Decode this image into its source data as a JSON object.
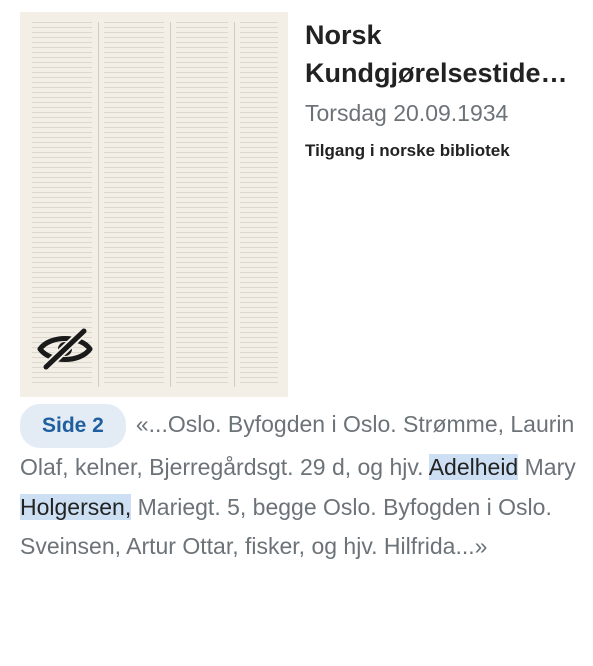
{
  "document": {
    "title_line1": "Norsk",
    "title_line2": "Kundgjørelsestide…",
    "date": "Torsdag 20.09.1934",
    "access": "Tilgang i norske bibliotek",
    "visibility_icon": "eye-slash-icon"
  },
  "snippet": {
    "page_label": "Side 2",
    "text_before": "«...Oslo. Byfogden i Oslo. Strømme, Laurin Olaf, kelner, Bjerregårdsgt. 29 d, og hjv. ",
    "highlight_1": "Adelheid",
    "text_middle": " Mary ",
    "highlight_2": "Holgersen,",
    "text_after": " Mariegt. 5, begge Oslo. Byfogden i Oslo. Sveinsen, Artur Ottar, fisker, og hjv. Hilfrida...»"
  },
  "colors": {
    "chip_bg": "#e3ecf5",
    "chip_text": "#1f5fa0",
    "highlight": "#cde0f3",
    "muted_text": "#6c7378"
  }
}
